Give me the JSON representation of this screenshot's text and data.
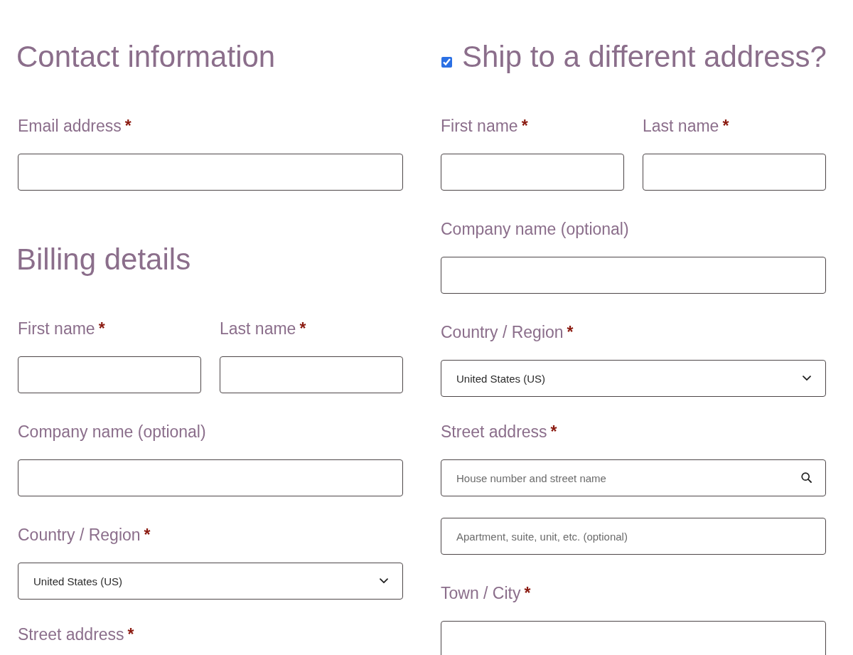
{
  "contact": {
    "heading": "Contact information",
    "rows": [
      {
        "fields": [
          {
            "kind": "text",
            "label": "Email address",
            "required_mark": "*"
          }
        ]
      }
    ]
  },
  "billing": {
    "heading": "Billing details",
    "rows": [
      {
        "fields": [
          {
            "kind": "text",
            "label": "First name",
            "required_mark": "*"
          },
          {
            "kind": "text",
            "label": "Last name",
            "required_mark": "*"
          }
        ]
      },
      {
        "fields": [
          {
            "kind": "text",
            "label": "Company name (optional)"
          }
        ]
      },
      {
        "fields": [
          {
            "kind": "select",
            "label": "Country / Region",
            "required_mark": "*",
            "value": "United States (US)"
          }
        ]
      },
      {
        "fields": [
          {
            "kind": "address",
            "label": "Street address",
            "required_mark": "*"
          }
        ]
      }
    ]
  },
  "shipping": {
    "toggle": {
      "label": "Ship to a different address?",
      "checked": true
    },
    "rows": [
      {
        "fields": [
          {
            "kind": "text",
            "label": "First name",
            "required_mark": "*"
          },
          {
            "kind": "text",
            "label": "Last name",
            "required_mark": "*"
          }
        ]
      },
      {
        "fields": [
          {
            "kind": "text",
            "label": "Company name (optional)"
          }
        ]
      },
      {
        "fields": [
          {
            "kind": "select",
            "label": "Country / Region",
            "required_mark": "*",
            "value": "United States (US)"
          }
        ]
      },
      {
        "fields": [
          {
            "kind": "address",
            "label": "Street address",
            "required_mark": "*",
            "lines": [
              {
                "placeholder": "House number and street name",
                "search": true
              },
              {
                "placeholder": "Apartment, suite, unit, etc. (optional)",
                "search": false
              }
            ]
          }
        ]
      },
      {
        "fields": [
          {
            "kind": "text",
            "label": "Town / City",
            "required_mark": "*"
          }
        ]
      }
    ]
  }
}
